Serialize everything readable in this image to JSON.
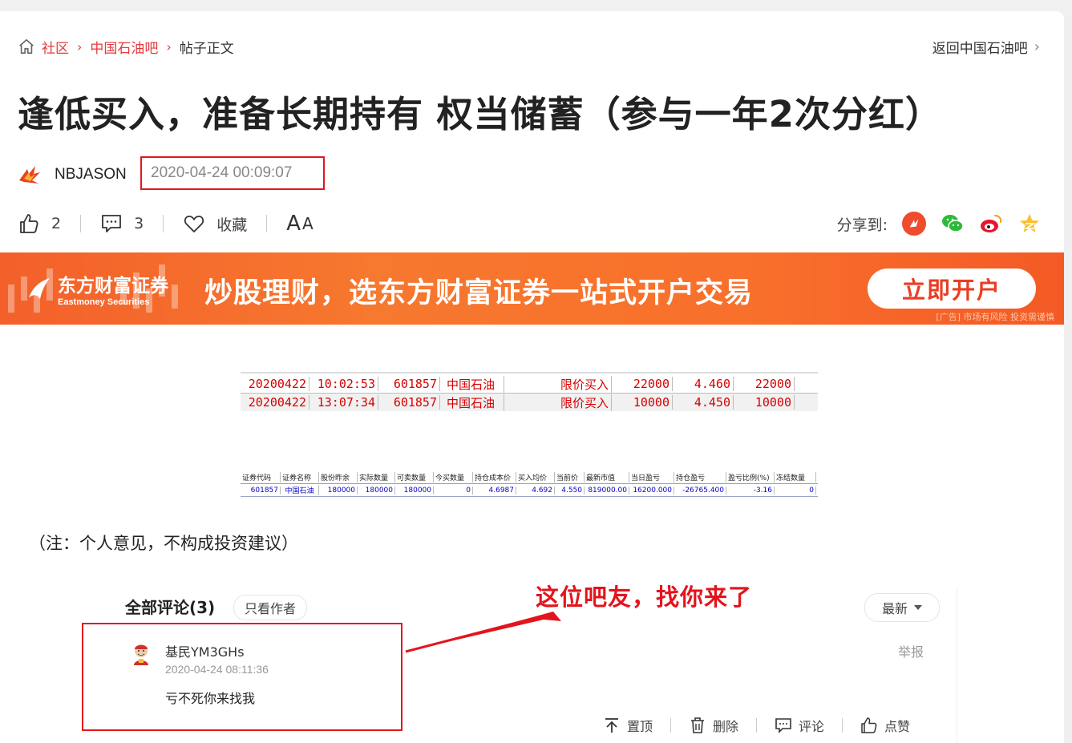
{
  "breadcrumb": {
    "items": [
      "社区",
      "中国石油吧",
      "帖子正文"
    ],
    "separator": "›"
  },
  "back_link": "返回中国石油吧",
  "post": {
    "title": "逢低买入，准备长期持有 权当储蓄（参与一年2次分红）",
    "author": "NBJASON",
    "time": "2020-04-24 00:09:07",
    "likes": "2",
    "comments": "3",
    "favorite_label": "收藏",
    "font_size_label_big": "A",
    "font_size_label_small": "A",
    "note": "（注：个人意见，不构成投资建议）"
  },
  "share": {
    "label": "分享到:",
    "targets": [
      "eastmoney-icon",
      "wechat-icon",
      "weibo-icon",
      "qzone-icon"
    ]
  },
  "ad": {
    "brand_cn": "东方财富证券",
    "brand_en": "Eastmoney Securities",
    "slogan": "炒股理财，选东方财富证券一站式开户交易",
    "button": "立即开户",
    "disclaimer": "[广告] 市场有风险 投资需谨慎"
  },
  "trades": {
    "rows": [
      [
        "20200422",
        "10:02:53",
        "601857",
        "中国石油",
        "",
        "限价买入",
        "22000",
        "4.460",
        "22000"
      ],
      [
        "20200422",
        "13:07:34",
        "601857",
        "中国石油",
        "",
        "限价买入",
        "10000",
        "4.450",
        "10000"
      ]
    ]
  },
  "holdings": {
    "headers": [
      "证券代码",
      "证券名称",
      "股份昨余",
      "实际数量",
      "可卖数量",
      "今买数量",
      "持仓成本价",
      "买入均价",
      "当前价",
      "最新市值",
      "当日盈亏",
      "持仓盈亏",
      "盈亏比例(%)",
      "冻结数量"
    ],
    "row": [
      "601857",
      "中国石油",
      "180000",
      "180000",
      "180000",
      "0",
      "4.6987",
      "4.692",
      "4.550",
      "819000.00",
      "16200.000",
      "-26765.400",
      "-3.16",
      "0"
    ]
  },
  "callout": "这位吧友，找你来了",
  "comments_section": {
    "title": "全部评论(3)",
    "only_author": "只看作者",
    "sort": "最新",
    "items": [
      {
        "user": "基民YM3GHs",
        "time": "2020-04-24 08:11:36",
        "text": "亏不死你来找我",
        "report": "举报"
      }
    ],
    "ops": {
      "pin": "置顶",
      "delete": "删除",
      "reply": "评论",
      "like": "点赞"
    }
  },
  "colors": {
    "accent_red": "#e4393c",
    "annotation_red": "#e4161f",
    "banner_orange": "#f7782f"
  }
}
